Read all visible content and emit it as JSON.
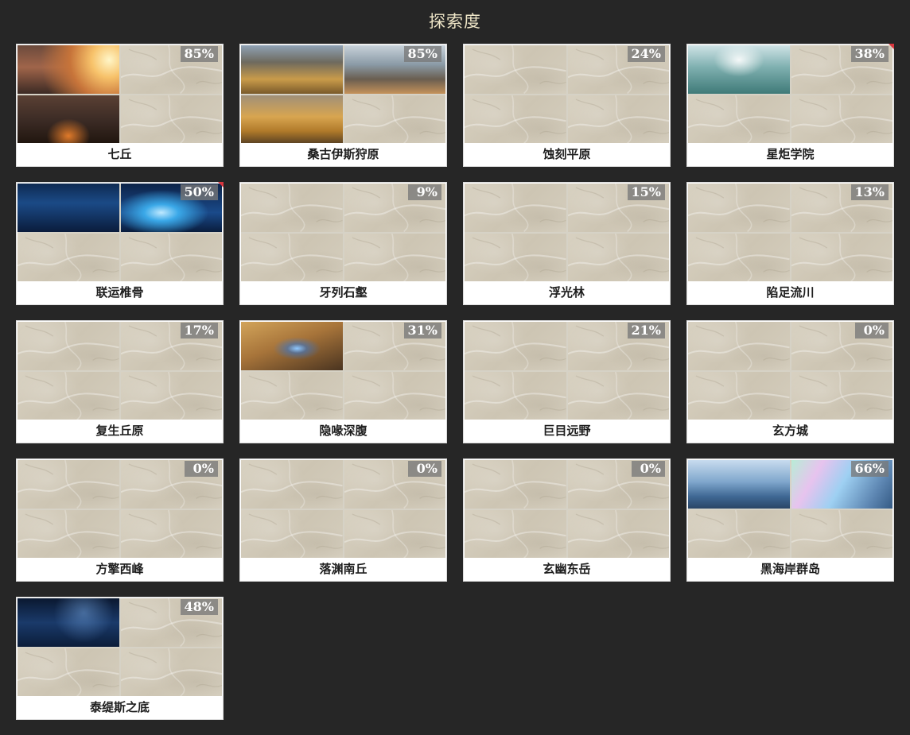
{
  "page": {
    "title": "探索度",
    "colors": {
      "background": "#262626",
      "title": "#efe6c8",
      "card": "#ffffff",
      "percent_badge": "#787878",
      "new_marker": "#d9363e"
    }
  },
  "regions": [
    {
      "name": "七丘",
      "percent": "85%",
      "revealed_tiles": [
        0,
        2
      ],
      "scene": "sunset-ruins",
      "marker": false
    },
    {
      "name": "桑古伊斯狩原",
      "percent": "85%",
      "revealed_tiles": [
        0,
        1,
        2
      ],
      "scene": "desert-city",
      "marker": false
    },
    {
      "name": "蚀刻平原",
      "percent": "24%",
      "revealed_tiles": [],
      "scene": "",
      "marker": false
    },
    {
      "name": "星炬学院",
      "percent": "38%",
      "revealed_tiles": [
        0
      ],
      "scene": "academy-rings",
      "marker": true
    },
    {
      "name": "联运椎骨",
      "percent": "50%",
      "revealed_tiles": [
        0,
        1
      ],
      "scene": "blue-cavern",
      "marker": true
    },
    {
      "name": "牙列石壑",
      "percent": "9%",
      "revealed_tiles": [],
      "scene": "",
      "marker": false
    },
    {
      "name": "浮光林",
      "percent": "15%",
      "revealed_tiles": [],
      "scene": "",
      "marker": false
    },
    {
      "name": "陷足流川",
      "percent": "13%",
      "revealed_tiles": [],
      "scene": "",
      "marker": false
    },
    {
      "name": "复生丘原",
      "percent": "17%",
      "revealed_tiles": [],
      "scene": "",
      "marker": false
    },
    {
      "name": "隐喙深腹",
      "percent": "31%",
      "revealed_tiles": [
        0
      ],
      "scene": "golden-serpent",
      "marker": false
    },
    {
      "name": "巨目远野",
      "percent": "21%",
      "revealed_tiles": [],
      "scene": "",
      "marker": false
    },
    {
      "name": "玄方城",
      "percent": "0%",
      "revealed_tiles": [],
      "scene": "",
      "marker": false
    },
    {
      "name": "方擎西峰",
      "percent": "0%",
      "revealed_tiles": [],
      "scene": "",
      "marker": false
    },
    {
      "name": "落渊南丘",
      "percent": "0%",
      "revealed_tiles": [],
      "scene": "",
      "marker": false
    },
    {
      "name": "玄幽东岳",
      "percent": "0%",
      "revealed_tiles": [],
      "scene": "",
      "marker": false
    },
    {
      "name": "黑海岸群岛",
      "percent": "66%",
      "revealed_tiles": [
        0,
        1
      ],
      "scene": "aurora-coast",
      "marker": false
    },
    {
      "name": "泰缇斯之底",
      "percent": "48%",
      "revealed_tiles": [
        0
      ],
      "scene": "deep-blue",
      "marker": false
    }
  ]
}
